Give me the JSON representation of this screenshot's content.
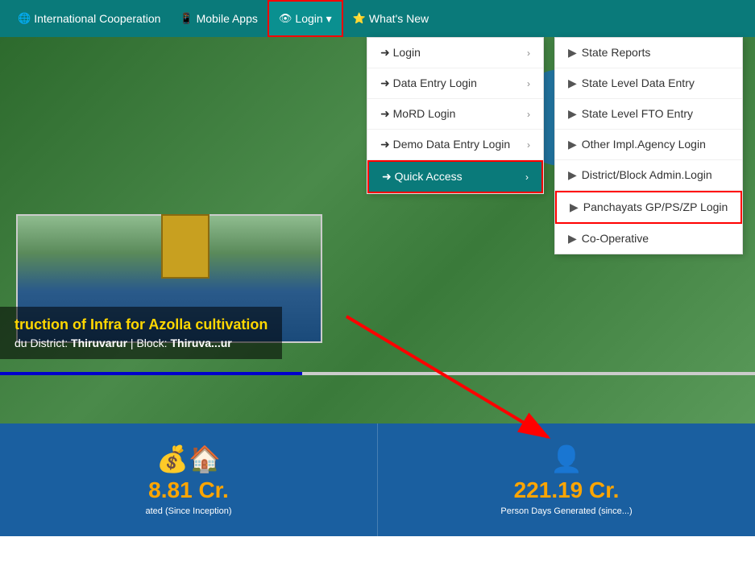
{
  "navbar": {
    "items": [
      {
        "label": "International Cooperation",
        "icon": "🌐"
      },
      {
        "label": "Mobile Apps",
        "icon": "📱"
      },
      {
        "label": "Login",
        "icon": "👁",
        "hasDropdown": true,
        "active": true
      },
      {
        "label": "What's New",
        "icon": "⭐"
      }
    ]
  },
  "dropdown": {
    "items": [
      {
        "label": "Login",
        "icon": "➜",
        "hasArrow": true
      },
      {
        "label": "Data Entry Login",
        "icon": "➜",
        "hasArrow": true
      },
      {
        "label": "MoRD Login",
        "icon": "➜",
        "hasArrow": true
      },
      {
        "label": "Demo Data Entry Login",
        "icon": "➜",
        "hasArrow": true
      },
      {
        "label": "Quick Access",
        "icon": "➜",
        "hasArrow": true,
        "active": true
      }
    ]
  },
  "submenu": {
    "items": [
      {
        "label": "State Reports"
      },
      {
        "label": "State Level Data Entry"
      },
      {
        "label": "State Level FTO Entry"
      },
      {
        "label": "Other Impl.Agency Login"
      },
      {
        "label": "District/Block Admin.Login"
      },
      {
        "label": "Panchayats GP/PS/ZP Login",
        "highlighted": true
      },
      {
        "label": "Co-Operative"
      }
    ]
  },
  "hero": {
    "title": "truction of Infra for Azolla cultivation",
    "subtitle_prefix": "du District: ",
    "district": "Thiruvarur",
    "block_prefix": " | Block: ",
    "block": "Thiruva...ur"
  },
  "stats": [
    {
      "amount": "8.81 Cr.",
      "label": "ated (Since Inception)",
      "icon": "💰"
    },
    {
      "amount": "221.19 Cr.",
      "label": "Person Days Generated (since...)",
      "icon": "👤"
    }
  ]
}
